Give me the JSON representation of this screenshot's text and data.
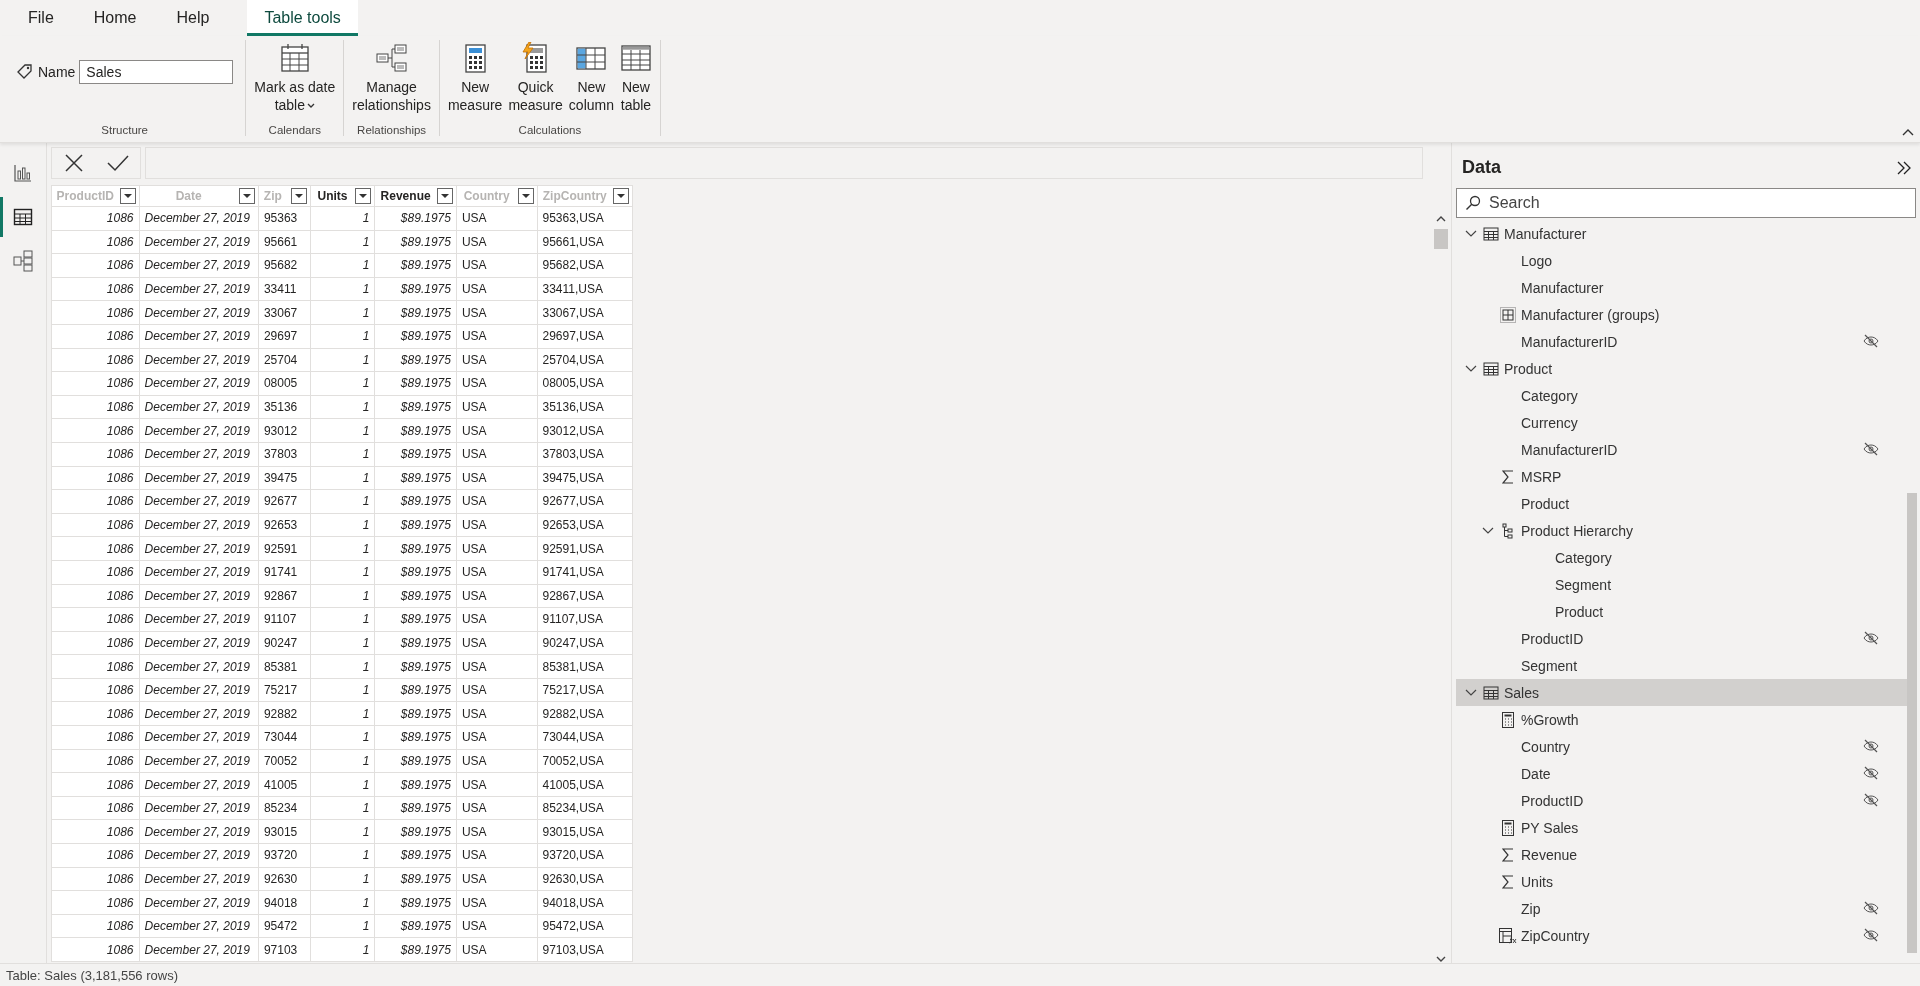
{
  "menu_tabs": [
    {
      "label": "File",
      "selected": false
    },
    {
      "label": "Home",
      "selected": false
    },
    {
      "label": "Help",
      "selected": false
    },
    {
      "label": "Table tools",
      "selected": true
    }
  ],
  "ribbon": {
    "name_label": "Name",
    "name_value": "Sales",
    "groups": [
      {
        "label": "Structure",
        "kind": "name"
      },
      {
        "label": "Calendars",
        "kind": "buttons",
        "buttons": [
          {
            "kind": "calendar",
            "label": "Mark as date\ntable",
            "dropdown": true
          }
        ]
      },
      {
        "label": "Relationships",
        "kind": "buttons",
        "buttons": [
          {
            "kind": "relationships",
            "label": "Manage\nrelationships",
            "dropdown": false
          }
        ]
      },
      {
        "label": "Calculations",
        "kind": "buttons",
        "buttons": [
          {
            "kind": "measure",
            "label": "New\nmeasure",
            "dropdown": false
          },
          {
            "kind": "quick-measure",
            "label": "Quick\nmeasure",
            "dropdown": false
          },
          {
            "kind": "column",
            "label": "New\ncolumn",
            "dropdown": false
          },
          {
            "kind": "table",
            "label": "New\ntable",
            "dropdown": false
          }
        ]
      }
    ]
  },
  "nav_rail": [
    {
      "kind": "report",
      "selected": false
    },
    {
      "kind": "table",
      "selected": true
    },
    {
      "kind": "model",
      "selected": false
    }
  ],
  "table": {
    "columns": [
      {
        "label": "ProductID",
        "hidden": true,
        "kind": "number"
      },
      {
        "label": "Date",
        "hidden": true,
        "kind": "date"
      },
      {
        "label": "Zip",
        "hidden": true,
        "kind": "text"
      },
      {
        "label": "Units",
        "hidden": false,
        "kind": "number"
      },
      {
        "label": "Revenue",
        "hidden": false,
        "kind": "number"
      },
      {
        "label": "Country",
        "hidden": true,
        "kind": "text"
      },
      {
        "label": "ZipCountry",
        "hidden": true,
        "kind": "text"
      }
    ],
    "rows": [
      [
        "1086",
        "December 27, 2019",
        "95363",
        "1",
        "$89.1975",
        "USA",
        "95363,USA"
      ],
      [
        "1086",
        "December 27, 2019",
        "95661",
        "1",
        "$89.1975",
        "USA",
        "95661,USA"
      ],
      [
        "1086",
        "December 27, 2019",
        "95682",
        "1",
        "$89.1975",
        "USA",
        "95682,USA"
      ],
      [
        "1086",
        "December 27, 2019",
        "33411",
        "1",
        "$89.1975",
        "USA",
        "33411,USA"
      ],
      [
        "1086",
        "December 27, 2019",
        "33067",
        "1",
        "$89.1975",
        "USA",
        "33067,USA"
      ],
      [
        "1086",
        "December 27, 2019",
        "29697",
        "1",
        "$89.1975",
        "USA",
        "29697,USA"
      ],
      [
        "1086",
        "December 27, 2019",
        "25704",
        "1",
        "$89.1975",
        "USA",
        "25704,USA"
      ],
      [
        "1086",
        "December 27, 2019",
        "08005",
        "1",
        "$89.1975",
        "USA",
        "08005,USA"
      ],
      [
        "1086",
        "December 27, 2019",
        "35136",
        "1",
        "$89.1975",
        "USA",
        "35136,USA"
      ],
      [
        "1086",
        "December 27, 2019",
        "93012",
        "1",
        "$89.1975",
        "USA",
        "93012,USA"
      ],
      [
        "1086",
        "December 27, 2019",
        "37803",
        "1",
        "$89.1975",
        "USA",
        "37803,USA"
      ],
      [
        "1086",
        "December 27, 2019",
        "39475",
        "1",
        "$89.1975",
        "USA",
        "39475,USA"
      ],
      [
        "1086",
        "December 27, 2019",
        "92677",
        "1",
        "$89.1975",
        "USA",
        "92677,USA"
      ],
      [
        "1086",
        "December 27, 2019",
        "92653",
        "1",
        "$89.1975",
        "USA",
        "92653,USA"
      ],
      [
        "1086",
        "December 27, 2019",
        "92591",
        "1",
        "$89.1975",
        "USA",
        "92591,USA"
      ],
      [
        "1086",
        "December 27, 2019",
        "91741",
        "1",
        "$89.1975",
        "USA",
        "91741,USA"
      ],
      [
        "1086",
        "December 27, 2019",
        "92867",
        "1",
        "$89.1975",
        "USA",
        "92867,USA"
      ],
      [
        "1086",
        "December 27, 2019",
        "91107",
        "1",
        "$89.1975",
        "USA",
        "91107,USA"
      ],
      [
        "1086",
        "December 27, 2019",
        "90247",
        "1",
        "$89.1975",
        "USA",
        "90247,USA"
      ],
      [
        "1086",
        "December 27, 2019",
        "85381",
        "1",
        "$89.1975",
        "USA",
        "85381,USA"
      ],
      [
        "1086",
        "December 27, 2019",
        "75217",
        "1",
        "$89.1975",
        "USA",
        "75217,USA"
      ],
      [
        "1086",
        "December 27, 2019",
        "92882",
        "1",
        "$89.1975",
        "USA",
        "92882,USA"
      ],
      [
        "1086",
        "December 27, 2019",
        "73044",
        "1",
        "$89.1975",
        "USA",
        "73044,USA"
      ],
      [
        "1086",
        "December 27, 2019",
        "70052",
        "1",
        "$89.1975",
        "USA",
        "70052,USA"
      ],
      [
        "1086",
        "December 27, 2019",
        "41005",
        "1",
        "$89.1975",
        "USA",
        "41005,USA"
      ],
      [
        "1086",
        "December 27, 2019",
        "85234",
        "1",
        "$89.1975",
        "USA",
        "85234,USA"
      ],
      [
        "1086",
        "December 27, 2019",
        "93015",
        "1",
        "$89.1975",
        "USA",
        "93015,USA"
      ],
      [
        "1086",
        "December 27, 2019",
        "93720",
        "1",
        "$89.1975",
        "USA",
        "93720,USA"
      ],
      [
        "1086",
        "December 27, 2019",
        "92630",
        "1",
        "$89.1975",
        "USA",
        "92630,USA"
      ],
      [
        "1086",
        "December 27, 2019",
        "94018",
        "1",
        "$89.1975",
        "USA",
        "94018,USA"
      ],
      [
        "1086",
        "December 27, 2019",
        "95472",
        "1",
        "$89.1975",
        "USA",
        "95472,USA"
      ],
      [
        "1086",
        "December 27, 2019",
        "97103",
        "1",
        "$89.1975",
        "USA",
        "97103,USA"
      ]
    ]
  },
  "data_pane": {
    "title": "Data",
    "search": {
      "placeholder": "Search"
    },
    "tree": [
      {
        "label": "Manufacturer",
        "kind": "table",
        "expanded": true,
        "selected": false,
        "hidden": false,
        "children": [
          {
            "label": "Logo",
            "kind": "field",
            "selected": false,
            "hidden": false
          },
          {
            "label": "Manufacturer",
            "kind": "field",
            "selected": false,
            "hidden": false
          },
          {
            "label": "Manufacturer (groups)",
            "kind": "group",
            "selected": false,
            "hidden": false
          },
          {
            "label": "ManufacturerID",
            "kind": "field",
            "selected": false,
            "hidden": true
          }
        ]
      },
      {
        "label": "Product",
        "kind": "table",
        "expanded": true,
        "selected": false,
        "hidden": false,
        "children": [
          {
            "label": "Category",
            "kind": "field",
            "selected": false,
            "hidden": false
          },
          {
            "label": "Currency",
            "kind": "field",
            "selected": false,
            "hidden": false
          },
          {
            "label": "ManufacturerID",
            "kind": "field",
            "selected": false,
            "hidden": true
          },
          {
            "label": "MSRP",
            "kind": "sum",
            "selected": false,
            "hidden": false
          },
          {
            "label": "Product",
            "kind": "field",
            "selected": false,
            "hidden": false
          },
          {
            "label": "Product Hierarchy",
            "kind": "hierarchy",
            "expanded": true,
            "selected": false,
            "hidden": false,
            "children": [
              {
                "label": "Category",
                "kind": "level",
                "selected": false,
                "hidden": false
              },
              {
                "label": "Segment",
                "kind": "level",
                "selected": false,
                "hidden": false
              },
              {
                "label": "Product",
                "kind": "level",
                "selected": false,
                "hidden": false
              }
            ]
          },
          {
            "label": "ProductID",
            "kind": "field",
            "selected": false,
            "hidden": true
          },
          {
            "label": "Segment",
            "kind": "field",
            "selected": false,
            "hidden": false
          }
        ]
      },
      {
        "label": "Sales",
        "kind": "table",
        "expanded": true,
        "selected": true,
        "hidden": false,
        "children": [
          {
            "label": "%Growth",
            "kind": "measure",
            "selected": false,
            "hidden": false
          },
          {
            "label": "Country",
            "kind": "field",
            "selected": false,
            "hidden": true
          },
          {
            "label": "Date",
            "kind": "field",
            "selected": false,
            "hidden": true
          },
          {
            "label": "ProductID",
            "kind": "field",
            "selected": false,
            "hidden": true
          },
          {
            "label": "PY Sales",
            "kind": "measure",
            "selected": false,
            "hidden": false
          },
          {
            "label": "Revenue",
            "kind": "sum",
            "selected": false,
            "hidden": false
          },
          {
            "label": "Units",
            "kind": "sum",
            "selected": false,
            "hidden": false
          },
          {
            "label": "Zip",
            "kind": "field",
            "selected": false,
            "hidden": true
          },
          {
            "label": "ZipCountry",
            "kind": "calc-column",
            "selected": false,
            "hidden": true
          }
        ]
      }
    ]
  },
  "status_bar": "Table: Sales (3,181,556 rows)"
}
